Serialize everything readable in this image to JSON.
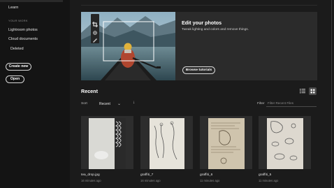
{
  "sidebar": {
    "learn": "Learn",
    "section_title": "YOUR WORK",
    "items": [
      "Lightroom photos",
      "Cloud documents",
      "Deleted"
    ],
    "create_new": "Create new",
    "open": "Open"
  },
  "hero": {
    "title": "Edit your photos",
    "subtitle": "Tweak lighting and colors and remove things.",
    "button": "Browse tutorials"
  },
  "recent": {
    "title": "Recent",
    "sort_label": "Sort",
    "sort_value": "Recent",
    "filter_label": "Filter",
    "filter_placeholder": "Filter Recent Files"
  },
  "files": [
    {
      "name": "tea_drop.jpg",
      "time": "16 minutes ago"
    },
    {
      "name": "graffiti_7",
      "time": "16 minutes ago"
    },
    {
      "name": "graffiti_6",
      "time": "11 minutes ago"
    },
    {
      "name": "graffiti_5",
      "time": "11 minutes ago"
    }
  ],
  "icons": {
    "crop": "crop-icon",
    "brush": "brush-icon",
    "list_view": "list-view-icon",
    "grid_view": "grid-view-icon",
    "sort_chevron": "chevron-down-icon",
    "sort_direction": "arrow-down-icon"
  }
}
